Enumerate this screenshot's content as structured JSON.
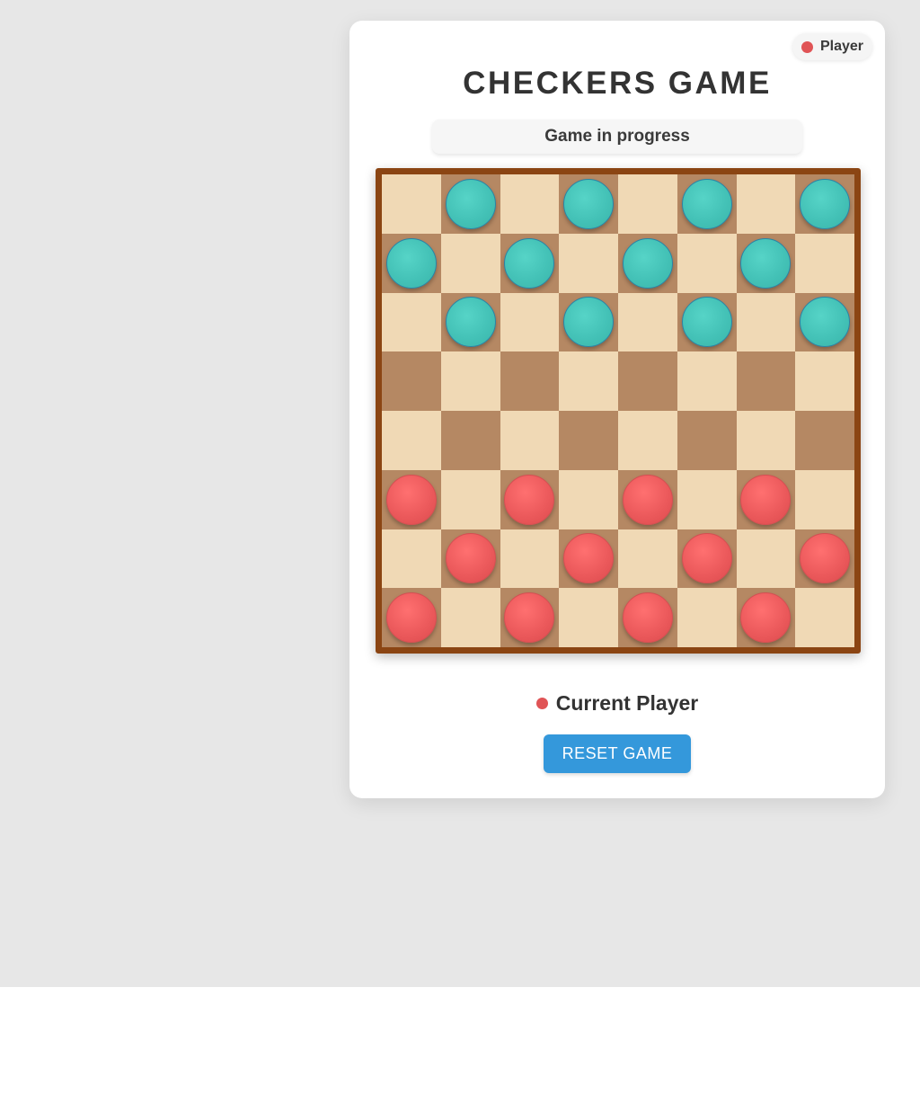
{
  "header": {
    "player_badge_label": "Player",
    "player_badge_color": "#e05456",
    "title": "CHECKERS GAME"
  },
  "status": {
    "text": "Game in progress"
  },
  "board": {
    "size": 8,
    "colors": {
      "light_square": "#f0d9b5",
      "dark_square": "#b58863",
      "border": "#8b4513",
      "teal_piece": "#45c4b8",
      "red_piece": "#ec5a5c"
    },
    "rows": [
      [
        "",
        "teal",
        "",
        "teal",
        "",
        "teal",
        "",
        "teal"
      ],
      [
        "teal",
        "",
        "teal",
        "",
        "teal",
        "",
        "teal",
        ""
      ],
      [
        "",
        "teal",
        "",
        "teal",
        "",
        "teal",
        "",
        "teal"
      ],
      [
        "",
        "",
        "",
        "",
        "",
        "",
        "",
        ""
      ],
      [
        "",
        "",
        "",
        "",
        "",
        "",
        "",
        ""
      ],
      [
        "red",
        "",
        "red",
        "",
        "red",
        "",
        "red",
        ""
      ],
      [
        "",
        "red",
        "",
        "red",
        "",
        "red",
        "",
        "red"
      ],
      [
        "red",
        "",
        "red",
        "",
        "red",
        "",
        "red",
        ""
      ]
    ]
  },
  "footer": {
    "current_player_label": "Current Player",
    "current_player_color": "#e05456",
    "reset_label": "RESET GAME",
    "reset_color": "#3498db"
  }
}
